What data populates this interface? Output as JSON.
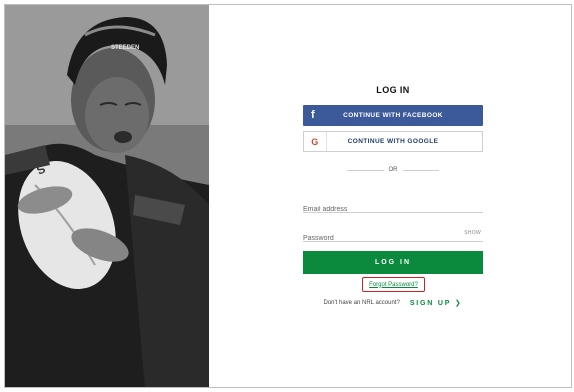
{
  "login": {
    "heading": "LOG IN",
    "facebook_label": "CONTINUE WITH FACEBOOK",
    "facebook_icon": "f",
    "google_label": "CONTINUE WITH GOOGLE",
    "google_icon": "G",
    "divider_text": "OR",
    "email_placeholder": "Email address",
    "password_placeholder": "Password",
    "show_label": "SHOW",
    "submit_label": "LOG IN",
    "forgot_label": "Forgot Password?",
    "no_account_text": "Don't have an NRL account?",
    "signup_label": "SIGN UP ❯"
  },
  "hero": {
    "cap_text": "STEEDEN"
  },
  "colors": {
    "facebook": "#3c5a9a",
    "primary_green": "#0b8a3e",
    "highlight_red": "#d32020"
  },
  "icons": {
    "facebook": "facebook-icon",
    "google": "google-icon"
  }
}
